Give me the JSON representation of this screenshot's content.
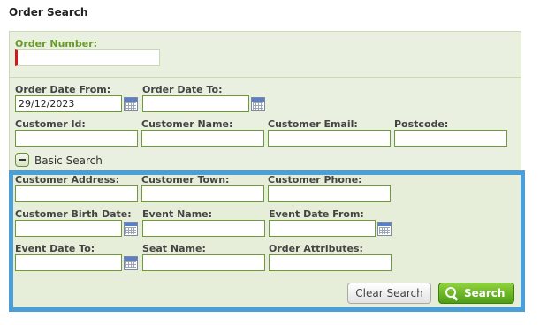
{
  "page": {
    "title": "Order Search"
  },
  "order_number": {
    "label": "Order Number:",
    "value": ""
  },
  "basic": {
    "order_date_from": {
      "label": "Order Date From:",
      "value": "29/12/2023"
    },
    "order_date_to": {
      "label": "Order Date To:",
      "value": ""
    },
    "customer_id": {
      "label": "Customer Id:",
      "value": ""
    },
    "customer_name": {
      "label": "Customer Name:",
      "value": ""
    },
    "customer_email": {
      "label": "Customer Email:",
      "value": ""
    },
    "postcode": {
      "label": "Postcode:",
      "value": ""
    },
    "toggle_label": "Basic Search"
  },
  "advanced": {
    "customer_address": {
      "label": "Customer Address:",
      "value": ""
    },
    "customer_town": {
      "label": "Customer Town:",
      "value": ""
    },
    "customer_phone": {
      "label": "Customer Phone:",
      "value": ""
    },
    "customer_birth_date": {
      "label": "Customer Birth Date:",
      "value": ""
    },
    "event_name": {
      "label": "Event Name:",
      "value": ""
    },
    "event_date_from": {
      "label": "Event Date From:",
      "value": ""
    },
    "event_date_to": {
      "label": "Event Date To:",
      "value": ""
    },
    "seat_name": {
      "label": "Seat Name:",
      "value": ""
    },
    "order_attributes": {
      "label": "Order Attributes:",
      "value": ""
    }
  },
  "buttons": {
    "clear_label": "Clear Search",
    "search_label": "Search"
  },
  "colors": {
    "accent_green": "#5aa51e",
    "highlight_border": "#4a9fd8",
    "required_marker": "#d0191b"
  },
  "icons": {
    "calendar": "calendar-icon",
    "collapse": "minus-icon",
    "search": "magnifier-icon"
  }
}
